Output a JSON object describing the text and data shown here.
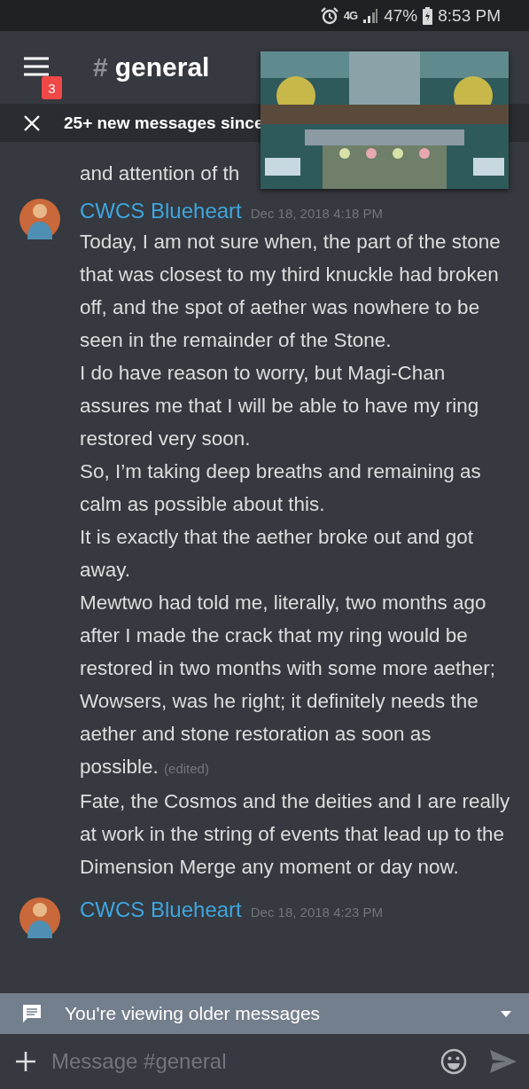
{
  "status_bar": {
    "network": "4G",
    "battery": "47%",
    "time": "8:53 PM"
  },
  "header": {
    "unread_badge": "3",
    "channel_prefix": "#",
    "channel": "general"
  },
  "new_messages_banner": {
    "text": "25+ new messages since"
  },
  "messages": [
    {
      "kind": "fragment",
      "text": "and attention of th"
    },
    {
      "kind": "group",
      "author": "CWCS Blueheart",
      "timestamp": "Dec 18, 2018 4:18 PM",
      "paragraphs": [
        {
          "text": "Today, I am not sure when, the part of the stone that was closest to my third knuckle had broken off, and the spot of aether was nowhere to be seen in the remainder of the Stone."
        },
        {
          "text": "I do have reason to worry, but Magi-Chan assures me that I will be able to have my ring restored very soon."
        },
        {
          "text": "So, I’m taking deep breaths and remaining as calm as possible about this."
        },
        {
          "text": "It is exactly that the aether broke out and got away."
        },
        {
          "text": "Mewtwo had told me, literally, two months ago after I made the crack that my ring would be restored in two months with some more aether; Wowsers, was he right; it definitely needs the aether and stone restoration as soon as possible.",
          "edited_label": "(edited)"
        },
        {
          "text": "Fate, the Cosmos and the deities and I are really at work in the string of events that lead up to the Dimension Merge any moment or day now."
        }
      ]
    },
    {
      "kind": "header_only",
      "author": "CWCS Blueheart",
      "timestamp": "Dec 18, 2018 4:23 PM"
    }
  ],
  "older_messages_bar": {
    "text": "You're viewing older messages"
  },
  "composer": {
    "placeholder": "Message #general"
  }
}
